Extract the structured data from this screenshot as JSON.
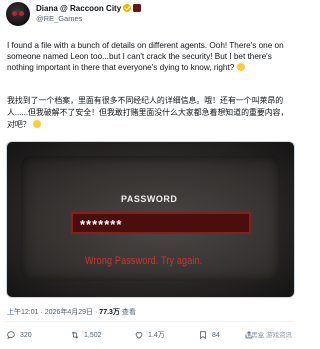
{
  "header": {
    "display_name": "Diana @ Raccoon City",
    "handle": "@RE_Games"
  },
  "post": {
    "text_en": "I found a file with a bunch of details on different agents. Ooh! There's one on someone named Leon too...but I can't crack the security! But I bet there's nothing important in there that everyone's dying to know, right?",
    "text_zh": "我找到了一个档案，里面有很多不同经纪人的详细信息。哦！还有一个叫莱昂的人......但我破解不了安全！但我敢打赌里面没什么大家都急着想知道的重要内容，对吧？",
    "image": {
      "password_label": "PASSWORD",
      "password_value": "*******",
      "error_text": "Wrong Password. Try again."
    }
  },
  "meta": {
    "time": "上午12:01",
    "date": "2026年4月29日",
    "views_count": "77.3万",
    "views_label": "查看"
  },
  "actions": {
    "reply_count": "320",
    "retweet_count": "1,502",
    "like_count": "1.4万",
    "bookmark_count": "84"
  },
  "watermark": "小黑盒 游戏资讯",
  "colors": {
    "verified_badge": "#f5b400",
    "error_red": "#d6322a",
    "password_box": "#4a0e0c"
  }
}
